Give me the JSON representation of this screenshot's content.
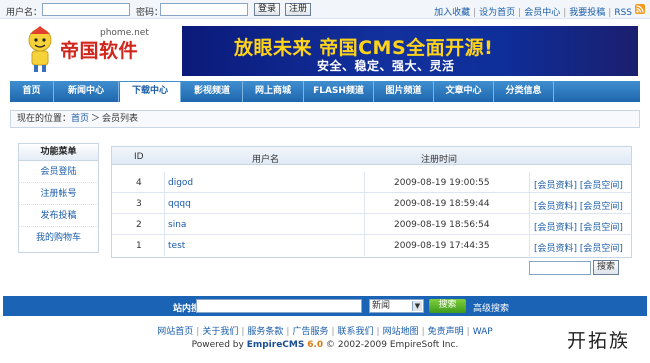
{
  "topbar": {
    "username_label": "用户名：",
    "password_label": "密码：",
    "login_button": "登录",
    "register_button": "注册",
    "links": [
      "加入收藏",
      "设为首页",
      "会员中心",
      "我要投稿",
      "RSS"
    ]
  },
  "header": {
    "logo_domain": "phome.net",
    "logo_text": "帝国软件",
    "banner_title": "放眼未来 帝国CMS全面开源!",
    "banner_subtitle": "安全、稳定、强大、灵活"
  },
  "nav": {
    "items": [
      "首页",
      "新闻中心",
      "下载中心",
      "影视频道",
      "网上商城",
      "FLASH频道",
      "图片频道",
      "文章中心",
      "分类信息"
    ],
    "active": "下载中心"
  },
  "breadcrumb": {
    "prefix": "现在的位置：",
    "home": "首页",
    "separator": "＞",
    "current": "会员列表"
  },
  "sidebar": {
    "title": "功能菜单",
    "items": [
      "会员登陆",
      "注册帐号",
      "发布投稿",
      "我的购物车"
    ]
  },
  "table": {
    "headers": [
      "ID",
      "用户名",
      "注册时间"
    ],
    "rows": [
      {
        "id": "4",
        "username": "digod",
        "time": "2009-08-19 19:00:55",
        "action": "[会员资料] [会员空间]"
      },
      {
        "id": "3",
        "username": "qqqq",
        "time": "2009-08-19 18:59:44",
        "action": "[会员资料] [会员空间]"
      },
      {
        "id": "2",
        "username": "sina",
        "time": "2009-08-19 18:56:54",
        "action": "[会员资料] [会员空间]"
      },
      {
        "id": "1",
        "username": "test",
        "time": "2009-08-19 17:44:35",
        "action": "[会员资料] [会员空间]"
      }
    ],
    "search_button": "搜索"
  },
  "bottom_search": {
    "label": "站内搜索：",
    "select_value": "新闻",
    "button": "搜索",
    "advanced": "高级搜索"
  },
  "footer": {
    "links": [
      "网站首页",
      "关于我们",
      "服务条款",
      "广告服务",
      "联系我们",
      "网站地图",
      "免责声明",
      "WAP"
    ],
    "powered_prefix": "Powered by",
    "brand": "EmpireCMS",
    "version": "6.0",
    "copyright": "© 2002-2009 EmpireSoft Inc.",
    "watermark": "开拓族"
  },
  "colors": {
    "nav": "#1f66ad",
    "banner": "#12319d",
    "banner_title": "#ffd319",
    "link": "#1a5caa",
    "search_bar": "#1b63b4",
    "search_button": "#3f9b1a"
  }
}
